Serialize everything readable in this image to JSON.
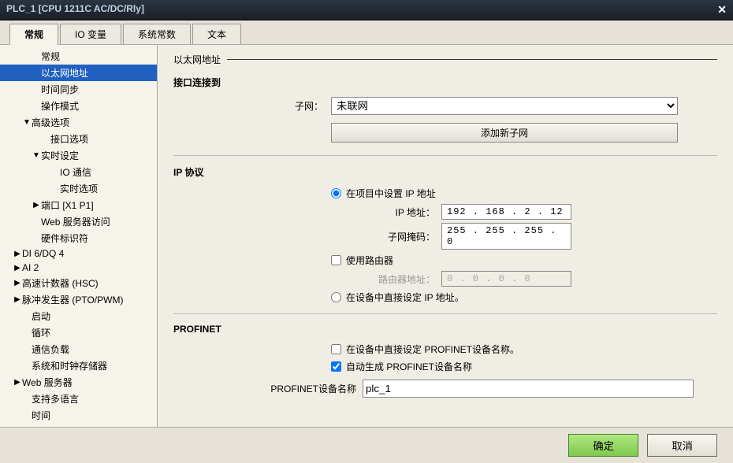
{
  "title": "PLC_1 [CPU 1211C AC/DC/Rly]",
  "tabs": [
    "常规",
    "IO 变量",
    "系统常数",
    "文本"
  ],
  "tree": [
    {
      "label": "常规",
      "indent": 2
    },
    {
      "label": "以太网地址",
      "indent": 2,
      "selected": true
    },
    {
      "label": "时间同步",
      "indent": 2
    },
    {
      "label": "操作模式",
      "indent": 2
    },
    {
      "label": "高级选项",
      "indent": 1,
      "caret": "▼"
    },
    {
      "label": "接口选项",
      "indent": 3
    },
    {
      "label": "实时设定",
      "indent": 2,
      "caret": "▼"
    },
    {
      "label": "IO 通信",
      "indent": 4
    },
    {
      "label": "实时选项",
      "indent": 4
    },
    {
      "label": "端口 [X1 P1]",
      "indent": 2,
      "caret": "▶"
    },
    {
      "label": "Web 服务器访问",
      "indent": 2
    },
    {
      "label": "硬件标识符",
      "indent": 2
    },
    {
      "label": "DI 6/DQ 4",
      "indent": 0,
      "caret": "▶"
    },
    {
      "label": "AI 2",
      "indent": 0,
      "caret": "▶"
    },
    {
      "label": "高速计数器 (HSC)",
      "indent": 0,
      "caret": "▶"
    },
    {
      "label": "脉冲发生器 (PTO/PWM)",
      "indent": 0,
      "caret": "▶"
    },
    {
      "label": "启动",
      "indent": 1
    },
    {
      "label": "循环",
      "indent": 1
    },
    {
      "label": "通信负载",
      "indent": 1
    },
    {
      "label": "系统和时钟存储器",
      "indent": 1
    },
    {
      "label": "Web 服务器",
      "indent": 0,
      "caret": "▶"
    },
    {
      "label": "支持多语言",
      "indent": 1
    },
    {
      "label": "时间",
      "indent": 1
    }
  ],
  "page": {
    "header": "以太网地址",
    "interface_section": "接口连接到",
    "subnet_label": "子网：",
    "subnet_value": "未联网",
    "add_subnet": "添加新子网",
    "ip_section": "IP 协议",
    "radio_project": "在项目中设置 IP 地址",
    "ip_label": "IP 地址：",
    "ip_value": "192 . 168 . 2    . 12",
    "mask_label": "子网掩码：",
    "mask_value": "255 . 255 . 255 . 0",
    "use_router": "使用路由器",
    "router_label": "路由器地址：",
    "router_value": "0    . 0    . 0    . 0",
    "radio_device": "在设备中直接设定 IP 地址。",
    "profinet_section": "PROFINET",
    "check_device_name": "在设备中直接设定 PROFINET设备名称。",
    "check_auto_name": "自动生成 PROFINET设备名称",
    "profinet_name_label": "PROFINET设备名称",
    "profinet_name_value": "plc_1"
  },
  "footer": {
    "ok": "确定",
    "cancel": "取消"
  }
}
